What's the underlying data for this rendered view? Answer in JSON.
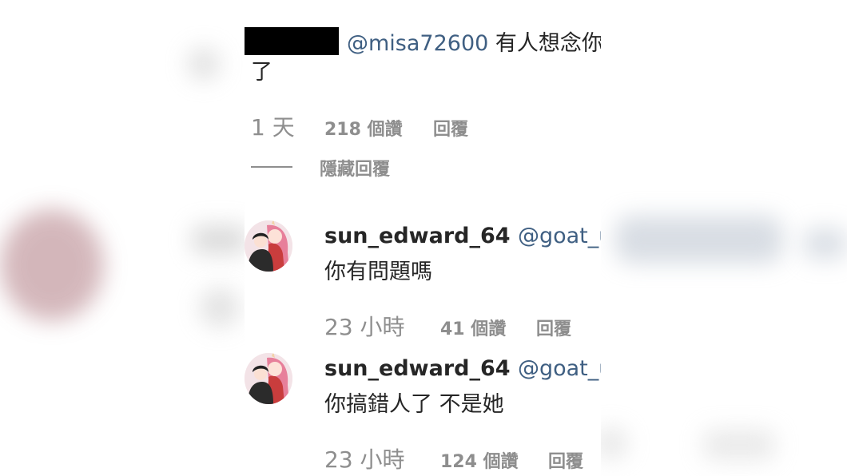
{
  "thread": {
    "top_comment": {
      "mention": "@misa72600",
      "text_line1": " 有人想念你",
      "text_line2": "了",
      "time": "1 天",
      "likes": "218 個讚",
      "reply_label": "回覆",
      "hide_replies_label": "隱藏回覆"
    },
    "replies": [
      {
        "username": "sun_edward_64",
        "mention": "@goat_uu",
        "text": "你有問題嗎",
        "time": "23 小時",
        "likes": "41 個讚",
        "reply_label": "回覆"
      },
      {
        "username": "sun_edward_64",
        "mention": "@goat_uu",
        "text": "你搞錯人了 不是她",
        "time": "23 小時",
        "likes": "124 個讚",
        "reply_label": "回覆"
      }
    ]
  },
  "colors": {
    "text": "#262626",
    "muted": "#8e8e8e",
    "mention": "#3f5f82",
    "redaction": "#000000"
  }
}
